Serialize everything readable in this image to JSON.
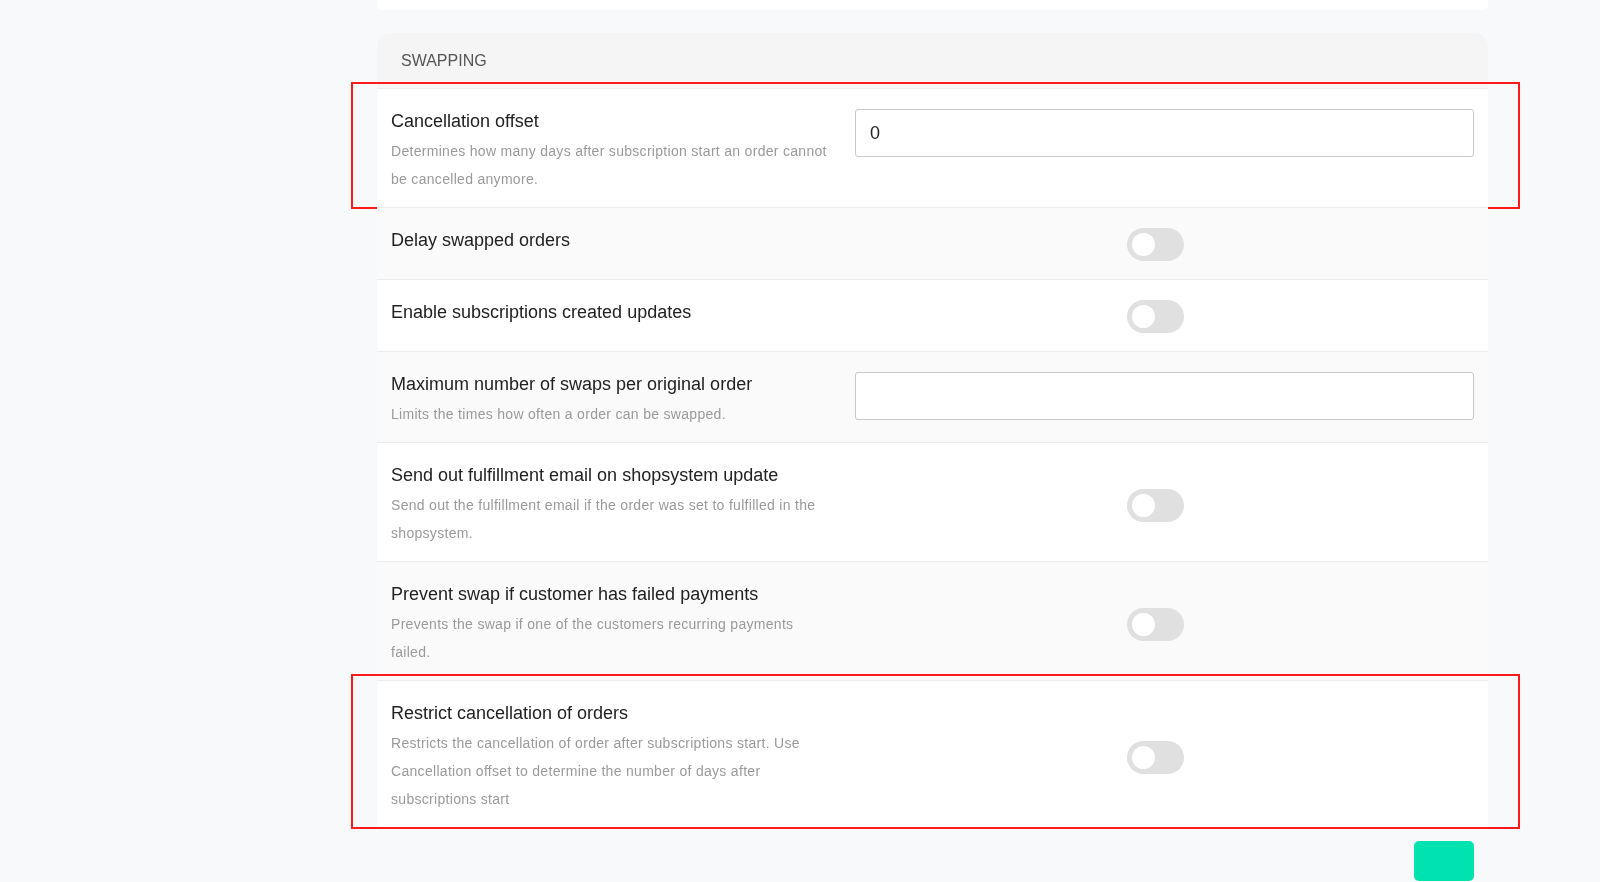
{
  "section": {
    "title": "SWAPPING"
  },
  "settings": [
    {
      "kind": "input",
      "label": "Cancellation offset",
      "description": "Determines how many days after subscription start an order cannot be cancelled anymore.",
      "value": "0",
      "highlighted": true
    },
    {
      "kind": "toggle",
      "label": "Delay swapped orders",
      "on": false,
      "highlighted": false
    },
    {
      "kind": "toggle",
      "label": "Enable subscriptions created updates",
      "on": false,
      "highlighted": false
    },
    {
      "kind": "input",
      "label": "Maximum number of swaps per original order",
      "description": "Limits the times how often a order can be swapped.",
      "highlighted": false
    },
    {
      "kind": "toggle",
      "label": "Send out fulfillment email on shopsystem update",
      "description": "Send out the fulfillment email if the order was set to fulfilled in the shopsystem.",
      "on": false,
      "highlighted": false
    },
    {
      "kind": "toggle",
      "label": "Prevent swap if customer has failed payments",
      "description": "Prevents the swap if one of the customers recurring payments failed.",
      "on": false,
      "highlighted": false
    },
    {
      "kind": "toggle",
      "label": "Restrict cancellation of orders",
      "description": "Restricts the cancellation of order after subscriptions start. Use Cancellation offset to determine the number of days after subscriptions start",
      "on": false,
      "highlighted": true
    }
  ]
}
